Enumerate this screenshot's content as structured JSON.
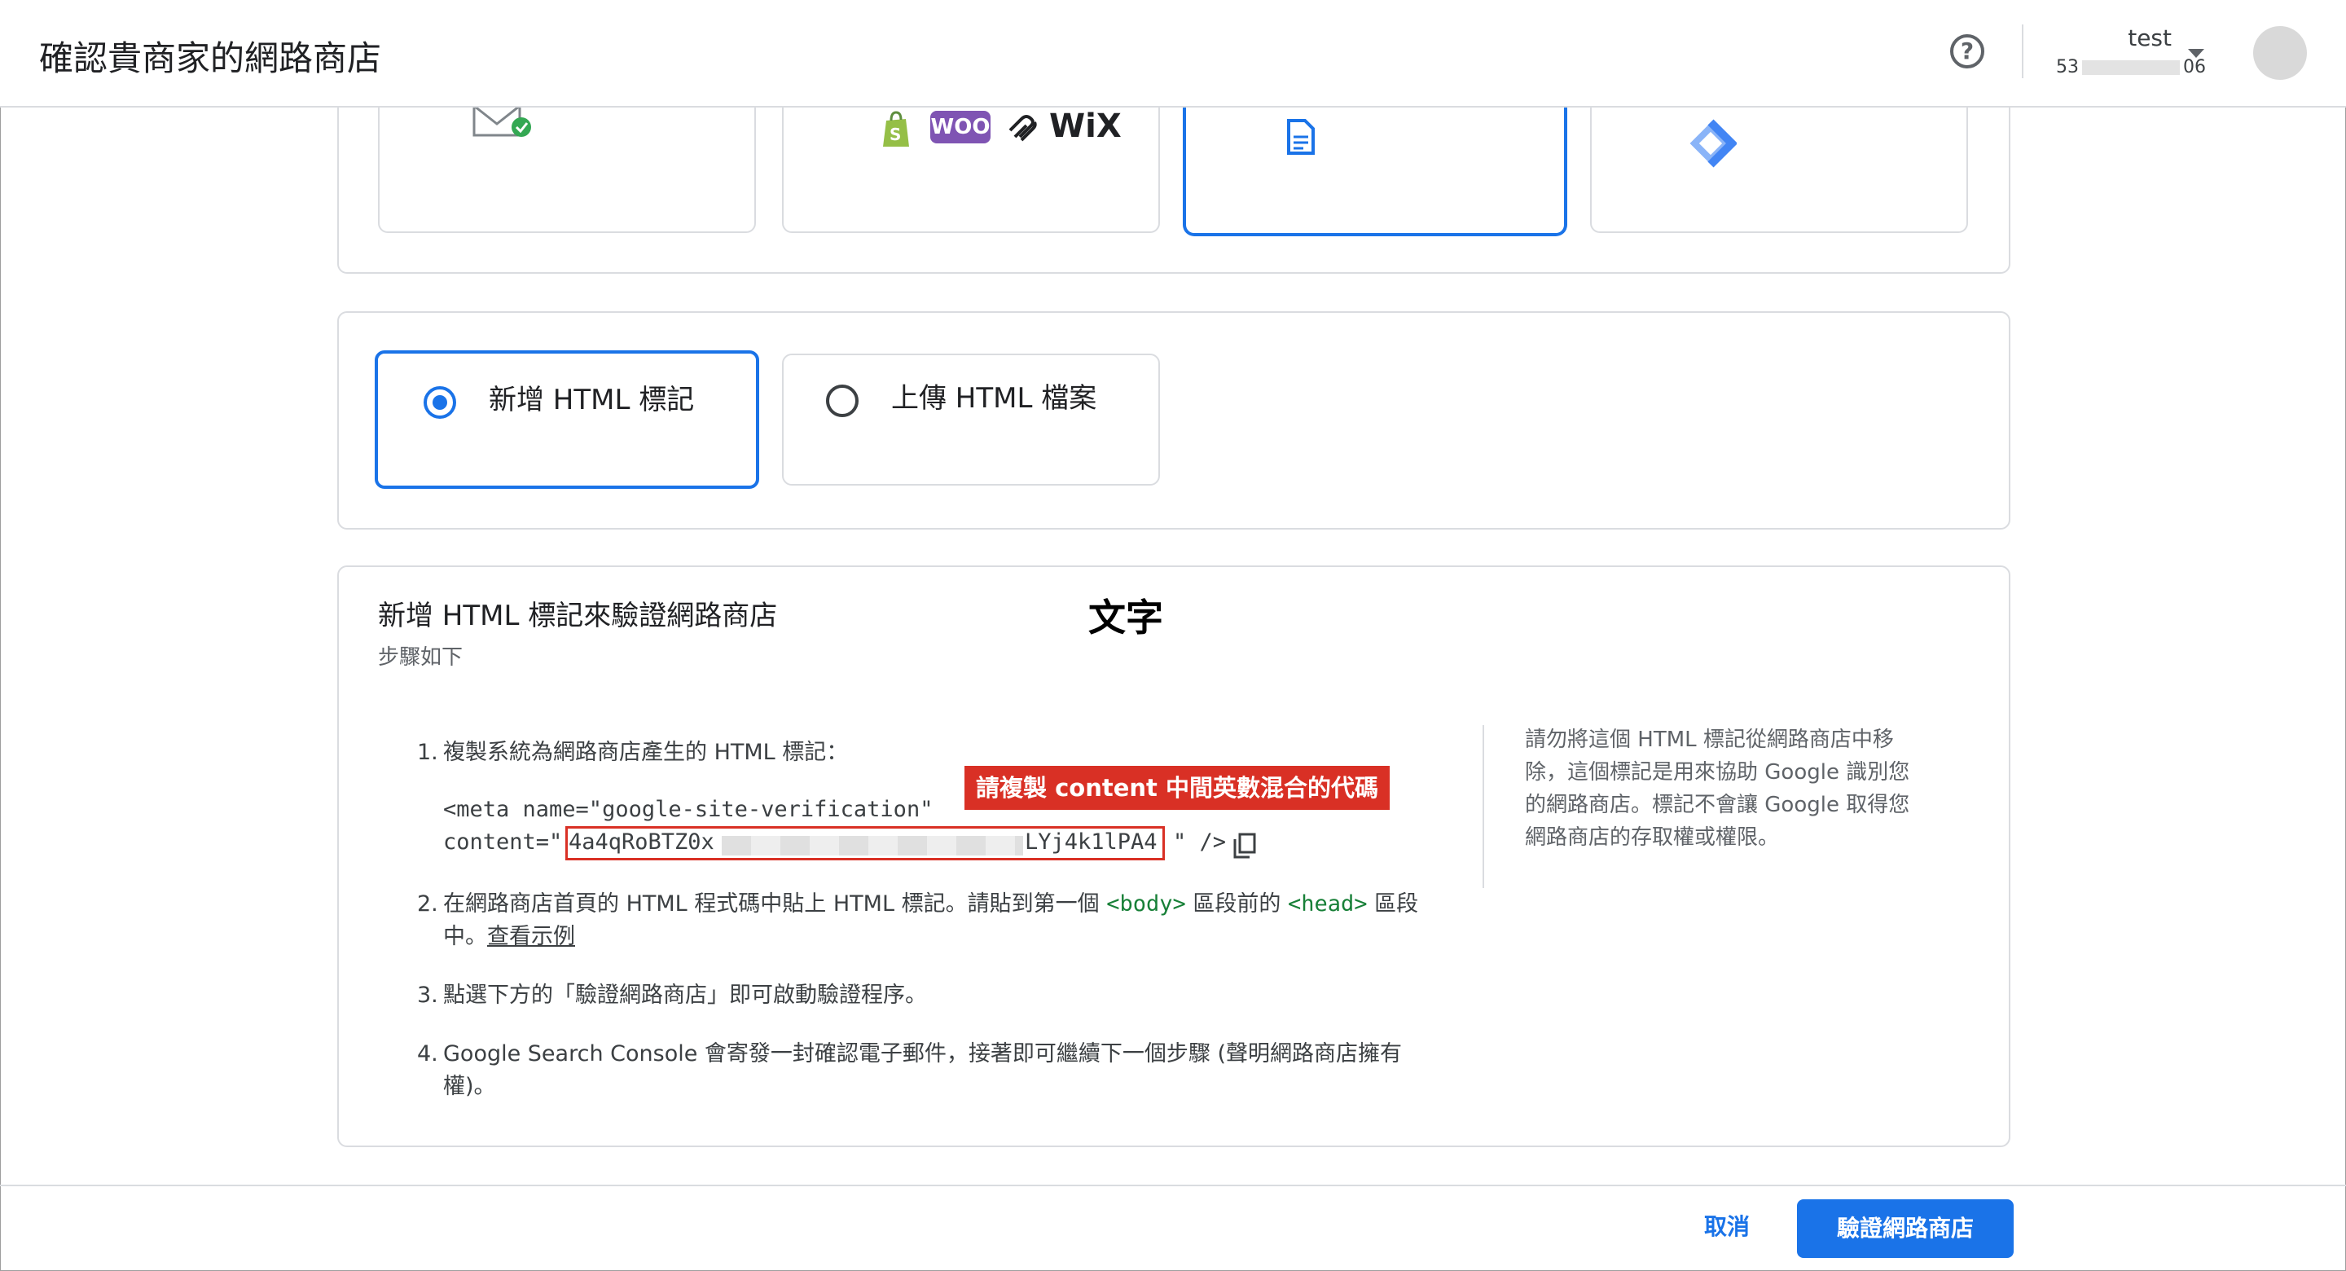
{
  "header": {
    "title": "確認貴商家的網路商店",
    "account_name": "test",
    "account_id_prefix": "53",
    "account_id_suffix": "06"
  },
  "methods": {
    "platforms": [
      "WOO",
      "WiX"
    ]
  },
  "tag_options": [
    {
      "label": "新增 HTML 標記",
      "selected": true
    },
    {
      "label": "上傳 HTML 檔案",
      "selected": false
    }
  ],
  "section": {
    "title": "新增 HTML 標記來驗證網路商店",
    "subtitle": "步驟如下",
    "overlay_label": "文字",
    "callout": "請複製 content 中間英數混合的代碼",
    "steps": {
      "s1_num": "1.",
      "s1_text": "複製系統為網路商店產生的 HTML 標記：",
      "meta_line1": "<meta name=\"google-site-verification\"",
      "meta_content_prefix": "content=\"",
      "content_start": "4a4qRoBTZ0x",
      "content_end": "LYj4k1lPA4",
      "meta_tail": "\" />",
      "s2_num": "2.",
      "s2_part1": "在網路商店首頁的 HTML 程式碼中貼上 HTML 標記。請貼到第一個",
      "s2_tag_body": "<body>",
      "s2_part2": "區段前的",
      "s2_tag_head": "<head>",
      "s2_part3": "區段中。",
      "s2_link": "查看示例",
      "s3_num": "3.",
      "s3_text": "點選下方的「驗證網路商店」即可啟動驗證程序。",
      "s4_num": "4.",
      "s4_text": "Google Search Console 會寄發一封確認電子郵件，接著即可繼續下一個步驟 (聲明網路商店擁有權)。"
    },
    "side_note": "請勿將這個 HTML 標記從網路商店中移除，這個標記是用來協助 Google 識別您的網路商店。標記不會讓 Google 取得您網路商店的存取權或權限。"
  },
  "footer": {
    "cancel": "取消",
    "verify": "驗證網路商店"
  },
  "colors": {
    "accent": "#1a73e8",
    "callout": "#d93025"
  }
}
